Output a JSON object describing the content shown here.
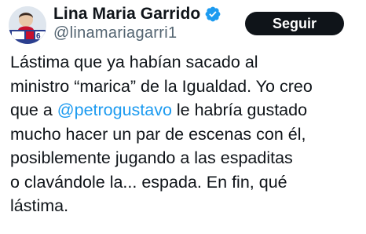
{
  "author": {
    "display_name": "Lina Maria Garrido",
    "handle": "@linamariagarri1",
    "avatar_badge": "6",
    "verified_color": "#1d9bf0"
  },
  "actions": {
    "follow_label": "Seguir"
  },
  "tweet": {
    "line1": "Lástima que ya habían sacado al",
    "line2": "ministro “marica” de la Igualdad. Yo creo",
    "line3_before": "que a ",
    "line3_mention": "@petrogustavo",
    "line3_after": " le habría gustado",
    "line4": "mucho hacer un par de escenas con él,",
    "line5": "posiblemente jugando a las espaditas",
    "line6": "o clavándole la... espada. En fin, qué",
    "line7": "lástima."
  },
  "colors": {
    "text": "#0f1419",
    "secondary": "#536471",
    "link": "#1d9bf0",
    "button_bg": "#0f1419",
    "button_text": "#ffffff"
  }
}
